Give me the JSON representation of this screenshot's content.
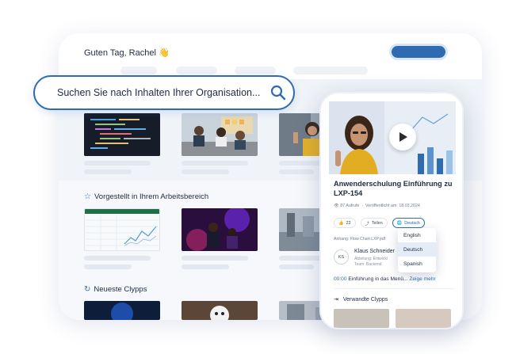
{
  "header": {
    "greeting": "Guten Tag, Rachel 👋"
  },
  "search": {
    "placeholder": "Suchen Sie nach Inhalten Ihrer Organisation..."
  },
  "sections": {
    "featured_title": "Vorgestellt in Ihrem Arbeitsbereich",
    "newest_title": "Neueste Clypps"
  },
  "video": {
    "title": "Anwenderschulung Einführung zu LXP-154",
    "views": "87 Aufrufe",
    "published": "Veröffentlicht am: 18.03.2024",
    "like_count": "23",
    "share_label": "Teilen",
    "language_label": "Deutsch",
    "attachment": "Anhang: Flow Chart LXP.pdf",
    "author_initials": "KS",
    "author_name": "Klaus Schneider",
    "author_line1": "Abteilung: Entwickl",
    "author_line2": "Team: Backend",
    "chapter_time": "00:00",
    "chapter_title": "Einführung in das Menü...",
    "chapter_more": "Zeige mehr",
    "related_title": "Verwandte Clypps"
  },
  "language_menu": {
    "options": [
      "English",
      "Deutsch",
      "Spanish"
    ],
    "selected": "Deutsch"
  },
  "colors": {
    "accent": "#2f6bb0",
    "background": "#f7f8fb"
  }
}
